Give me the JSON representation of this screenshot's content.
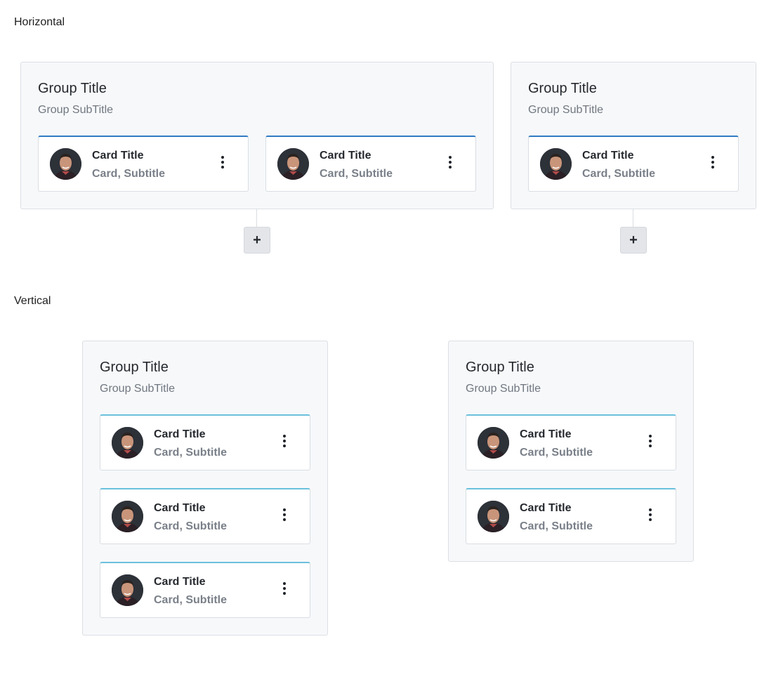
{
  "sections": {
    "horizontal_label": "Horizontal",
    "vertical_label": "Vertical"
  },
  "group": {
    "title": "Group Title",
    "subtitle": "Group SubTitle"
  },
  "card": {
    "title": "Card Title",
    "subtitle": "Card, Subtitle"
  },
  "add_button": {
    "label": "+"
  },
  "icons": {
    "more": "kebab-menu-icon",
    "add": "plus-icon"
  },
  "colors": {
    "horizontal_card_accent": "#2f7bc3",
    "vertical_card_accent": "#6ac0dd",
    "group_background": "#f7f8fa"
  }
}
